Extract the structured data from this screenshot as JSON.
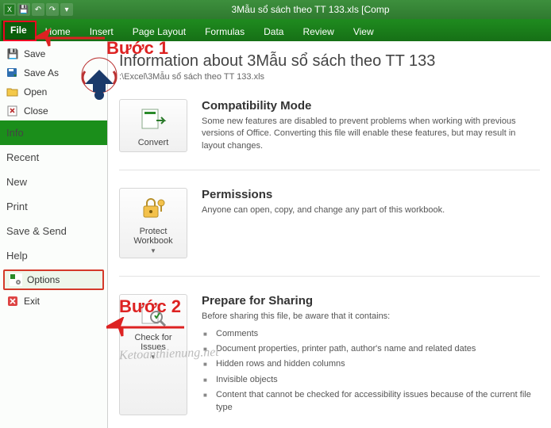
{
  "titlebar": {
    "title": "3Mẫu sổ sách theo TT 133.xls  [Comp"
  },
  "ribbon": {
    "file": "File",
    "tabs": [
      "Home",
      "Insert",
      "Page Layout",
      "Formulas",
      "Data",
      "Review",
      "View"
    ]
  },
  "backstage_menu": {
    "save": "Save",
    "saveas": "Save As",
    "open": "Open",
    "close": "Close",
    "info": "Info",
    "recent": "Recent",
    "new": "New",
    "print": "Print",
    "savesend": "Save & Send",
    "help": "Help",
    "options": "Options",
    "exit": "Exit"
  },
  "content": {
    "heading": "Information about 3Mẫu sổ sách theo TT 133",
    "path": ":\\Excel\\3Mẫu sổ sách theo TT 133.xls",
    "compat": {
      "btn": "Convert",
      "title": "Compatibility Mode",
      "text": "Some new features are disabled to prevent problems when working with previous versions of Office. Converting this file will enable these features, but may result in layout changes."
    },
    "perm": {
      "btn": "Protect Workbook",
      "title": "Permissions",
      "text": "Anyone can open, copy, and change any part of this workbook."
    },
    "prep": {
      "btn": "Check for Issues",
      "title": "Prepare for Sharing",
      "intro": "Before sharing this file, be aware that it contains:",
      "items": [
        "Comments",
        "Document properties, printer path, author's name and related dates",
        "Hidden rows and hidden columns",
        "Invisible objects",
        "Content that cannot be checked for accessibility issues because of the current file type"
      ]
    }
  },
  "annotations": {
    "step1": "Bước 1",
    "step2": "Bước 2",
    "watermark": "Ketoanthienung.net"
  }
}
